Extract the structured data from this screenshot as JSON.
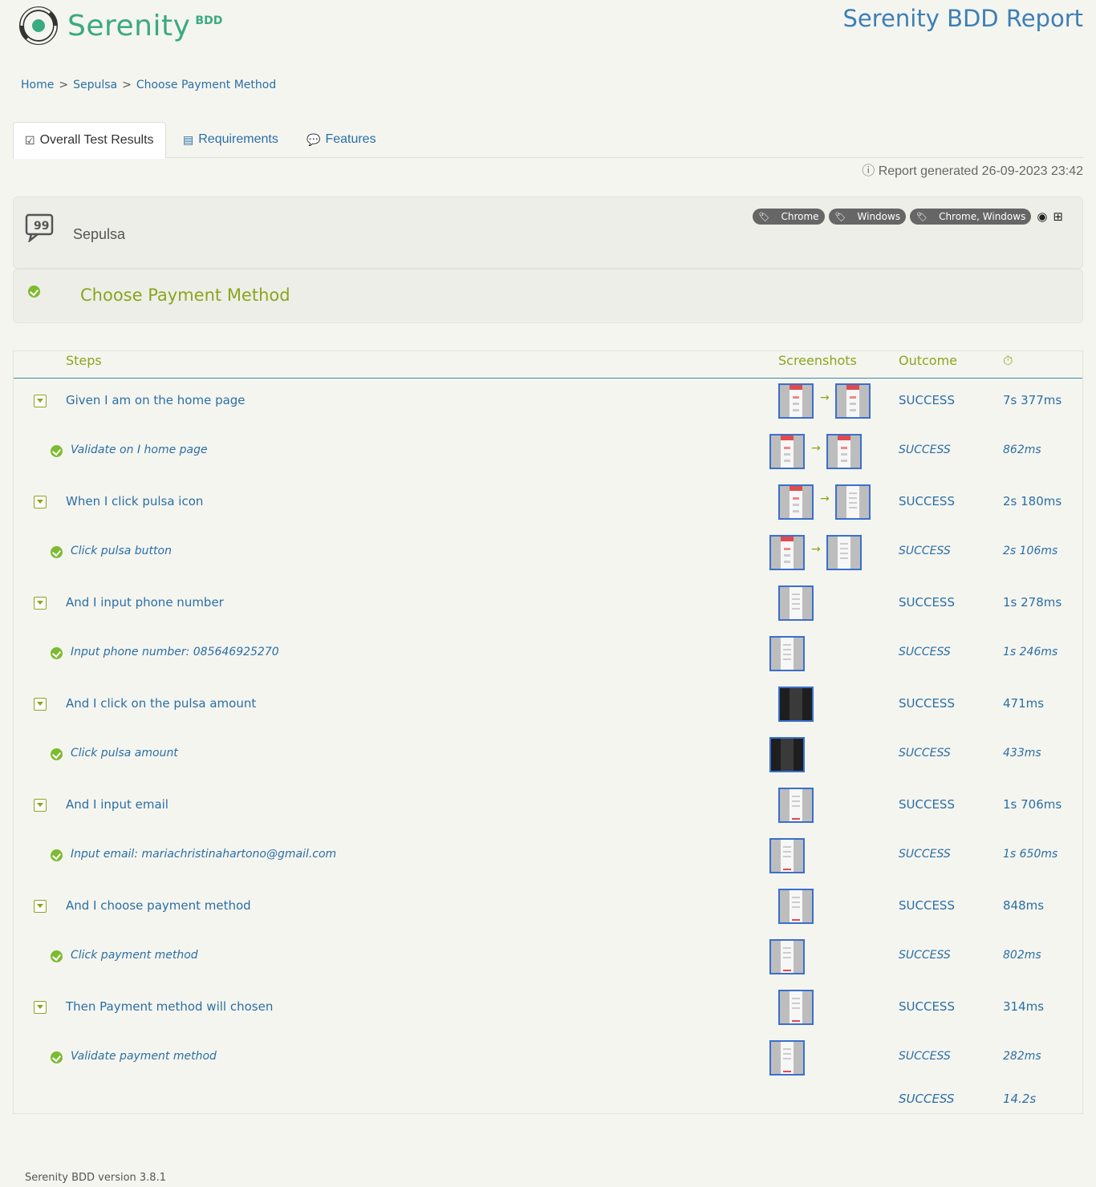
{
  "header": {
    "logo_text": "Serenity",
    "logo_sub": "BDD",
    "report_title": "Serenity BDD Report"
  },
  "breadcrumb": [
    "Home",
    "Sepulsa",
    "Choose Payment Method"
  ],
  "tabs": [
    {
      "label": "Overall Test Results",
      "icon": "checklist-icon",
      "active": true
    },
    {
      "label": "Requirements",
      "icon": "list-icon",
      "active": false
    },
    {
      "label": "Features",
      "icon": "comment-icon",
      "active": false
    }
  ],
  "report_generated": "Report generated 26-09-2023 23:42",
  "feature": {
    "name": "Sepulsa",
    "tags": [
      "Chrome",
      "Windows",
      "Chrome, Windows"
    ]
  },
  "scenario": {
    "title": "Choose Payment Method"
  },
  "table": {
    "headers": {
      "steps": "Steps",
      "screenshots": "Screenshots",
      "outcome": "Outcome",
      "duration_icon": "stopwatch-icon"
    },
    "rows": [
      {
        "text": "Given I am on the home page",
        "sub": false,
        "outcome": "SUCCESS",
        "duration": "7s 377ms",
        "shots": [
          "red",
          "red"
        ]
      },
      {
        "text": "Validate on I home page",
        "sub": true,
        "outcome": "SUCCESS",
        "duration": "862ms",
        "shots": [
          "red",
          "red"
        ]
      },
      {
        "text": "When I click pulsa icon",
        "sub": false,
        "outcome": "SUCCESS",
        "duration": "2s 180ms",
        "shots": [
          "red",
          "form"
        ]
      },
      {
        "text": "Click pulsa button",
        "sub": true,
        "outcome": "SUCCESS",
        "duration": "2s 106ms",
        "shots": [
          "red",
          "form"
        ]
      },
      {
        "text": "And I input phone number",
        "sub": false,
        "outcome": "SUCCESS",
        "duration": "1s 278ms",
        "shots": [
          "form"
        ]
      },
      {
        "text": "Input phone number: 085646925270",
        "sub": true,
        "outcome": "SUCCESS",
        "duration": "1s 246ms",
        "shots": [
          "form"
        ]
      },
      {
        "text": "And I click on the pulsa amount",
        "sub": false,
        "outcome": "SUCCESS",
        "duration": "471ms",
        "shots": [
          "dark"
        ]
      },
      {
        "text": "Click pulsa amount",
        "sub": true,
        "outcome": "SUCCESS",
        "duration": "433ms",
        "shots": [
          "dark"
        ]
      },
      {
        "text": "And I input email",
        "sub": false,
        "outcome": "SUCCESS",
        "duration": "1s 706ms",
        "shots": [
          "formred"
        ]
      },
      {
        "text": "Input email: mariachristinahartono@gmail.com",
        "sub": true,
        "outcome": "SUCCESS",
        "duration": "1s 650ms",
        "shots": [
          "formred"
        ]
      },
      {
        "text": "And I choose payment method",
        "sub": false,
        "outcome": "SUCCESS",
        "duration": "848ms",
        "shots": [
          "formred"
        ]
      },
      {
        "text": "Click payment method",
        "sub": true,
        "outcome": "SUCCESS",
        "duration": "802ms",
        "shots": [
          "formred"
        ]
      },
      {
        "text": "Then Payment method will chosen",
        "sub": false,
        "outcome": "SUCCESS",
        "duration": "314ms",
        "shots": [
          "formred"
        ]
      },
      {
        "text": "Validate payment method",
        "sub": true,
        "outcome": "SUCCESS",
        "duration": "282ms",
        "shots": [
          "formred"
        ]
      }
    ],
    "total": {
      "outcome": "SUCCESS",
      "duration": "14.2s"
    }
  },
  "footer": "Serenity BDD version 3.8.1",
  "colors": {
    "accent_green": "#8aa51c",
    "link_blue": "#2a6fa5",
    "success_green": "#7dbb2f"
  }
}
